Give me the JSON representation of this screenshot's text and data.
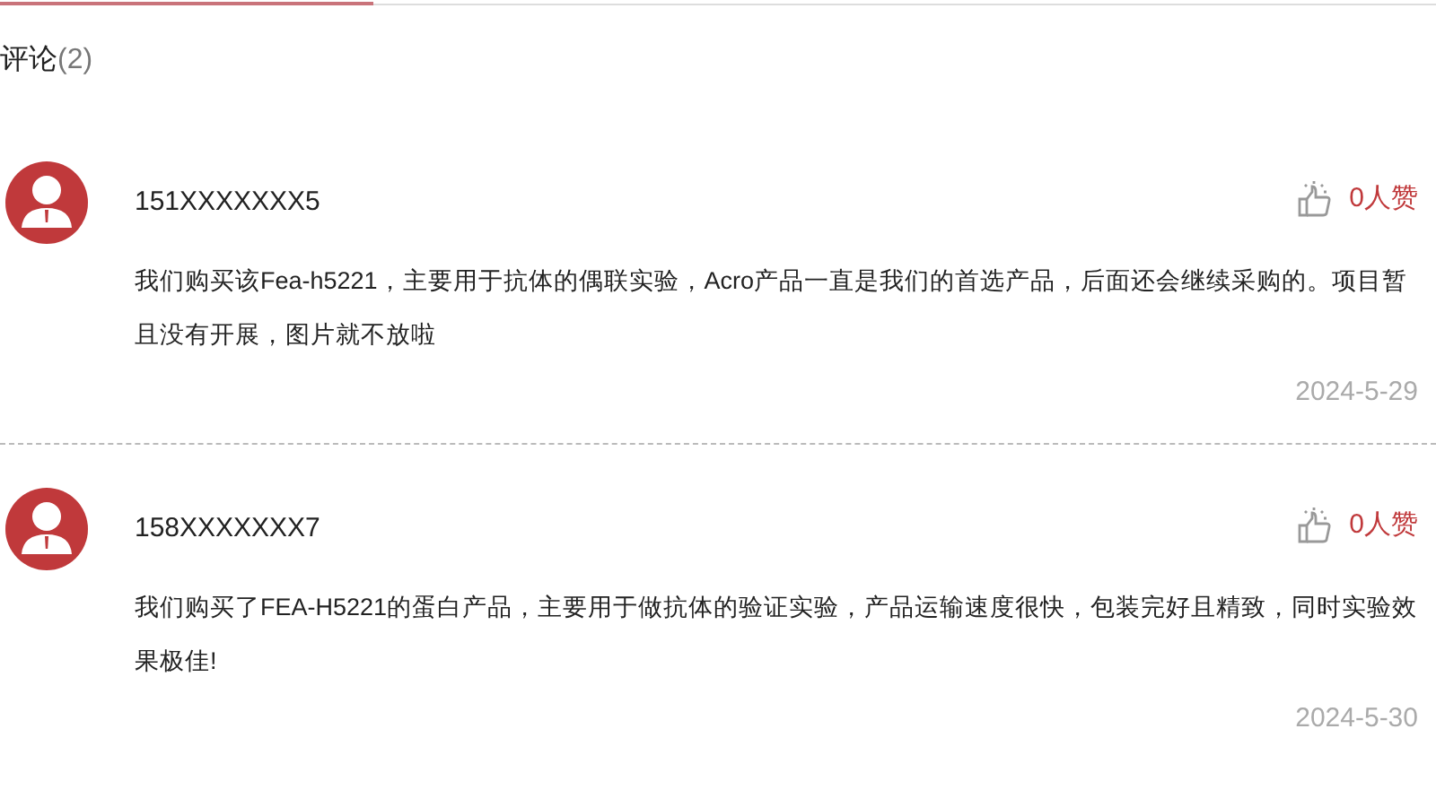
{
  "heading": {
    "title": "评论",
    "count": "(2)"
  },
  "comments": [
    {
      "user": "151XXXXXXX5",
      "likes": "0人赞",
      "text": "我们购买该Fea-h5221，主要用于抗体的偶联实验，Acro产品一直是我们的首选产品，后面还会继续采购的。项目暂且没有开展，图片就不放啦",
      "date": "2024-5-29"
    },
    {
      "user": "158XXXXXXX7",
      "likes": "0人赞",
      "text": "我们购买了FEA-H5221的蛋白产品，主要用于做抗体的验证实验，产品运输速度很快，包装完好且精致，同时实验效果极佳!",
      "date": "2024-5-30"
    }
  ]
}
